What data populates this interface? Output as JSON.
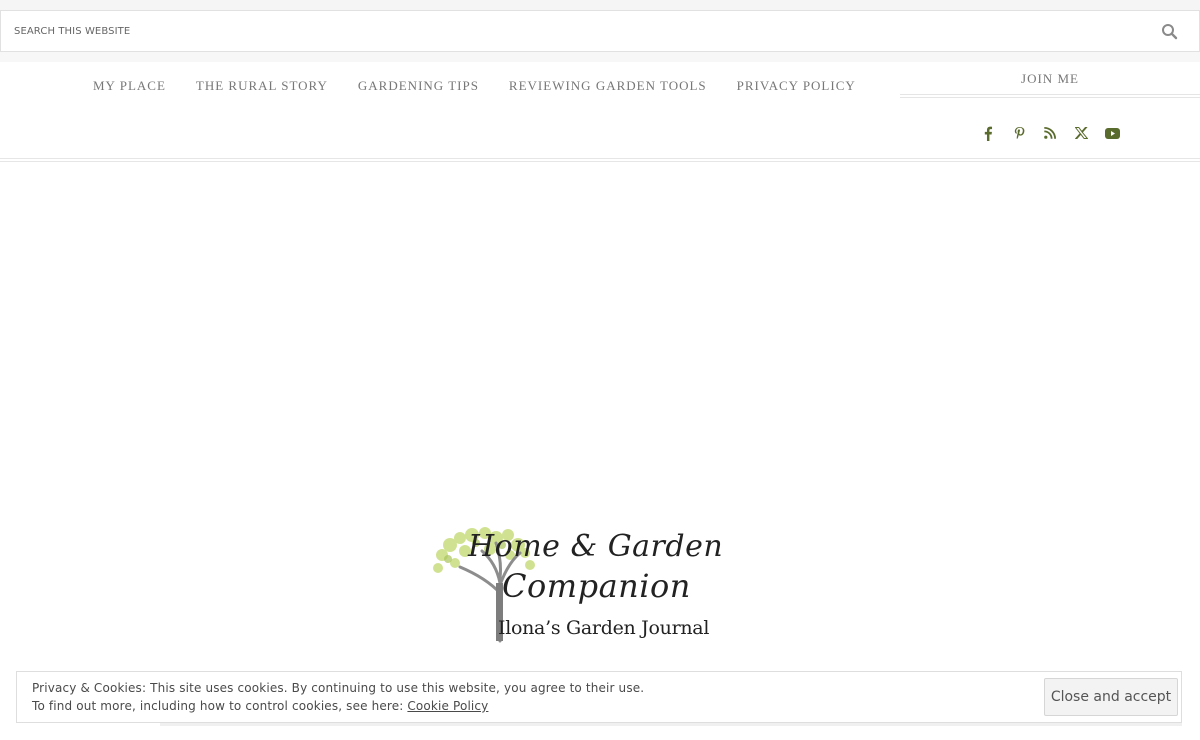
{
  "search": {
    "placeholder": "SEARCH THIS WEBSITE",
    "icon": "search-icon"
  },
  "nav": {
    "items": [
      {
        "label": "MY PLACE"
      },
      {
        "label": "THE RURAL STORY"
      },
      {
        "label": "GARDENING TIPS"
      },
      {
        "label": "REVIEWING GARDEN TOOLS"
      },
      {
        "label": "PRIVACY POLICY"
      }
    ]
  },
  "sidebar": {
    "title": "JOIN ME",
    "social": [
      {
        "icon": "facebook-icon"
      },
      {
        "icon": "pinterest-icon"
      },
      {
        "icon": "rss-icon"
      },
      {
        "icon": "x-twitter-icon"
      },
      {
        "icon": "youtube-icon"
      }
    ],
    "icon_color": "#5a6b2e"
  },
  "logo": {
    "line1": "Home & Garden",
    "line2": "Companion",
    "line3": "Ilona’s Garden Journal",
    "leaf_color": "#c8de7e"
  },
  "cookie": {
    "line1": "Privacy & Cookies: This site uses cookies. By continuing to use this website, you agree to their use.",
    "line2_prefix": "To find out more, including how to control cookies, see here: ",
    "link": "Cookie Policy",
    "button": "Close and accept"
  }
}
